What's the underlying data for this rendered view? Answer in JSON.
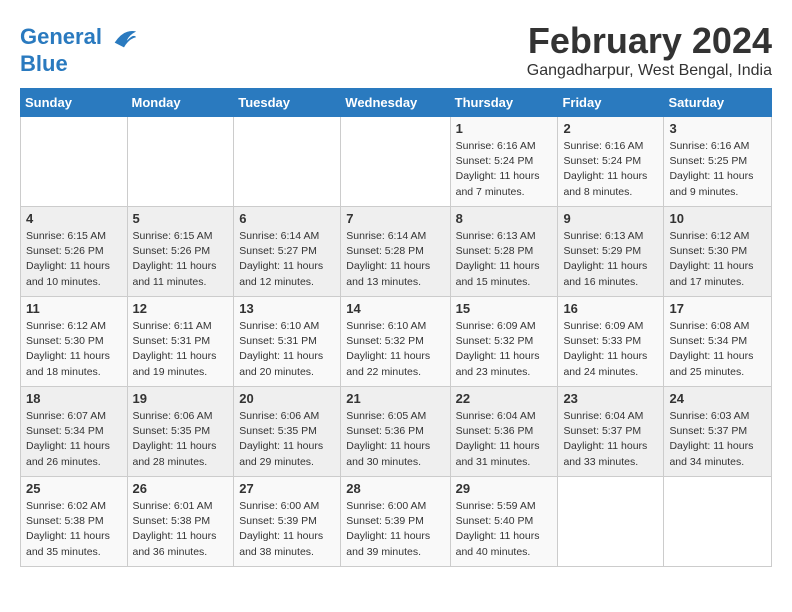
{
  "header": {
    "logo_line1": "General",
    "logo_line2": "Blue",
    "month_year": "February 2024",
    "location": "Gangadharpur, West Bengal, India"
  },
  "days_of_week": [
    "Sunday",
    "Monday",
    "Tuesday",
    "Wednesday",
    "Thursday",
    "Friday",
    "Saturday"
  ],
  "weeks": [
    [
      {
        "num": "",
        "info": ""
      },
      {
        "num": "",
        "info": ""
      },
      {
        "num": "",
        "info": ""
      },
      {
        "num": "",
        "info": ""
      },
      {
        "num": "1",
        "info": "Sunrise: 6:16 AM\nSunset: 5:24 PM\nDaylight: 11 hours\nand 7 minutes."
      },
      {
        "num": "2",
        "info": "Sunrise: 6:16 AM\nSunset: 5:24 PM\nDaylight: 11 hours\nand 8 minutes."
      },
      {
        "num": "3",
        "info": "Sunrise: 6:16 AM\nSunset: 5:25 PM\nDaylight: 11 hours\nand 9 minutes."
      }
    ],
    [
      {
        "num": "4",
        "info": "Sunrise: 6:15 AM\nSunset: 5:26 PM\nDaylight: 11 hours\nand 10 minutes."
      },
      {
        "num": "5",
        "info": "Sunrise: 6:15 AM\nSunset: 5:26 PM\nDaylight: 11 hours\nand 11 minutes."
      },
      {
        "num": "6",
        "info": "Sunrise: 6:14 AM\nSunset: 5:27 PM\nDaylight: 11 hours\nand 12 minutes."
      },
      {
        "num": "7",
        "info": "Sunrise: 6:14 AM\nSunset: 5:28 PM\nDaylight: 11 hours\nand 13 minutes."
      },
      {
        "num": "8",
        "info": "Sunrise: 6:13 AM\nSunset: 5:28 PM\nDaylight: 11 hours\nand 15 minutes."
      },
      {
        "num": "9",
        "info": "Sunrise: 6:13 AM\nSunset: 5:29 PM\nDaylight: 11 hours\nand 16 minutes."
      },
      {
        "num": "10",
        "info": "Sunrise: 6:12 AM\nSunset: 5:30 PM\nDaylight: 11 hours\nand 17 minutes."
      }
    ],
    [
      {
        "num": "11",
        "info": "Sunrise: 6:12 AM\nSunset: 5:30 PM\nDaylight: 11 hours\nand 18 minutes."
      },
      {
        "num": "12",
        "info": "Sunrise: 6:11 AM\nSunset: 5:31 PM\nDaylight: 11 hours\nand 19 minutes."
      },
      {
        "num": "13",
        "info": "Sunrise: 6:10 AM\nSunset: 5:31 PM\nDaylight: 11 hours\nand 20 minutes."
      },
      {
        "num": "14",
        "info": "Sunrise: 6:10 AM\nSunset: 5:32 PM\nDaylight: 11 hours\nand 22 minutes."
      },
      {
        "num": "15",
        "info": "Sunrise: 6:09 AM\nSunset: 5:32 PM\nDaylight: 11 hours\nand 23 minutes."
      },
      {
        "num": "16",
        "info": "Sunrise: 6:09 AM\nSunset: 5:33 PM\nDaylight: 11 hours\nand 24 minutes."
      },
      {
        "num": "17",
        "info": "Sunrise: 6:08 AM\nSunset: 5:34 PM\nDaylight: 11 hours\nand 25 minutes."
      }
    ],
    [
      {
        "num": "18",
        "info": "Sunrise: 6:07 AM\nSunset: 5:34 PM\nDaylight: 11 hours\nand 26 minutes."
      },
      {
        "num": "19",
        "info": "Sunrise: 6:06 AM\nSunset: 5:35 PM\nDaylight: 11 hours\nand 28 minutes."
      },
      {
        "num": "20",
        "info": "Sunrise: 6:06 AM\nSunset: 5:35 PM\nDaylight: 11 hours\nand 29 minutes."
      },
      {
        "num": "21",
        "info": "Sunrise: 6:05 AM\nSunset: 5:36 PM\nDaylight: 11 hours\nand 30 minutes."
      },
      {
        "num": "22",
        "info": "Sunrise: 6:04 AM\nSunset: 5:36 PM\nDaylight: 11 hours\nand 31 minutes."
      },
      {
        "num": "23",
        "info": "Sunrise: 6:04 AM\nSunset: 5:37 PM\nDaylight: 11 hours\nand 33 minutes."
      },
      {
        "num": "24",
        "info": "Sunrise: 6:03 AM\nSunset: 5:37 PM\nDaylight: 11 hours\nand 34 minutes."
      }
    ],
    [
      {
        "num": "25",
        "info": "Sunrise: 6:02 AM\nSunset: 5:38 PM\nDaylight: 11 hours\nand 35 minutes."
      },
      {
        "num": "26",
        "info": "Sunrise: 6:01 AM\nSunset: 5:38 PM\nDaylight: 11 hours\nand 36 minutes."
      },
      {
        "num": "27",
        "info": "Sunrise: 6:00 AM\nSunset: 5:39 PM\nDaylight: 11 hours\nand 38 minutes."
      },
      {
        "num": "28",
        "info": "Sunrise: 6:00 AM\nSunset: 5:39 PM\nDaylight: 11 hours\nand 39 minutes."
      },
      {
        "num": "29",
        "info": "Sunrise: 5:59 AM\nSunset: 5:40 PM\nDaylight: 11 hours\nand 40 minutes."
      },
      {
        "num": "",
        "info": ""
      },
      {
        "num": "",
        "info": ""
      }
    ]
  ]
}
